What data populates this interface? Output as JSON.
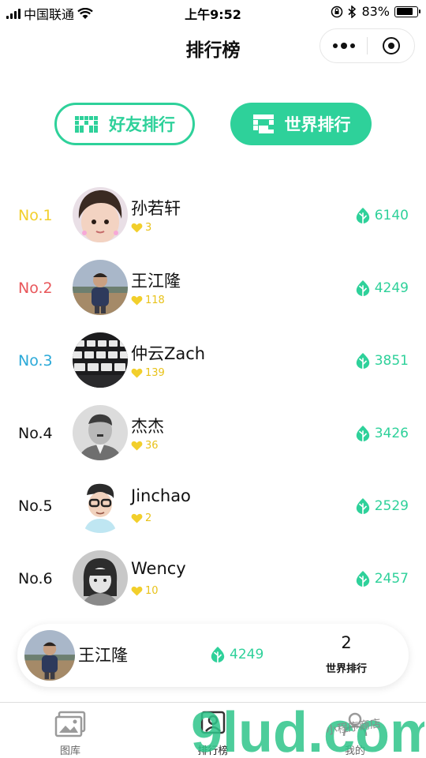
{
  "status_bar": {
    "carrier": "中国联通",
    "time": "上午9:52",
    "battery": "83%",
    "battery_level": 0.83
  },
  "header": {
    "title": "排行榜"
  },
  "tabs": [
    {
      "label": "好友排行",
      "active": false
    },
    {
      "label": "世界排行",
      "active": true
    }
  ],
  "ranking": [
    {
      "rank": "No.1",
      "name": "孙若轩",
      "likes": "3",
      "score": "6140",
      "rank_color": "#f2cf2b"
    },
    {
      "rank": "No.2",
      "name": "王江隆",
      "likes": "118",
      "score": "4249",
      "rank_color": "#e8565a"
    },
    {
      "rank": "No.3",
      "name": "仲云Zach",
      "likes": "139",
      "score": "3851",
      "rank_color": "#2ba9d8"
    },
    {
      "rank": "No.4",
      "name": "杰杰",
      "likes": "36",
      "score": "3426",
      "rank_color": "#111111"
    },
    {
      "rank": "No.5",
      "name": "Jinchao",
      "likes": "2",
      "score": "2529",
      "rank_color": "#111111"
    },
    {
      "rank": "No.6",
      "name": "Wency",
      "likes": "10",
      "score": "2457",
      "rank_color": "#111111"
    }
  ],
  "my_rank": {
    "name": "王江隆",
    "score": "4249",
    "rank_number": "2",
    "rank_label": "世界排行"
  },
  "tab_bar": [
    {
      "label": "图库",
      "icon": "gallery-icon",
      "active": false
    },
    {
      "label": "排行榜",
      "icon": "leaderboard-icon",
      "active": true
    },
    {
      "label": "我的",
      "icon": "profile-icon",
      "active": false
    }
  ],
  "watermark": {
    "text": "9lud.com",
    "subtext": "小程序商店"
  },
  "colors": {
    "accent": "#2ed19a",
    "likes": "#f2cf2b",
    "rank1": "#f2cf2b",
    "rank2": "#e8565a",
    "rank3": "#2ba9d8"
  },
  "icons": {
    "score": "leaf-icon",
    "likes": "heart-icon"
  }
}
